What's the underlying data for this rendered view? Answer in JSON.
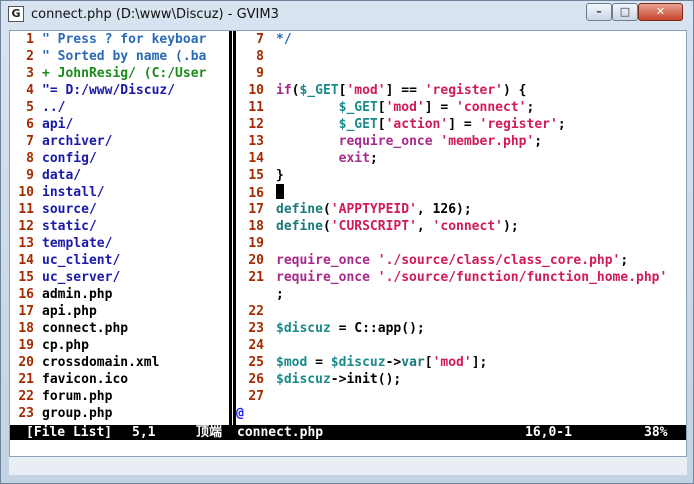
{
  "window": {
    "title": "connect.php (D:\\www\\Discuz) - GVIM3",
    "icon_glyph": "G"
  },
  "controls": {
    "minimize": "–",
    "maximize": "□",
    "close": "✕"
  },
  "left_pane": {
    "lines": [
      {
        "n": "1",
        "text": "\" Press ? for keyboar",
        "cls": "comment"
      },
      {
        "n": "2",
        "text": "\" Sorted by name (.ba",
        "cls": "comment"
      },
      {
        "n": "3",
        "text": "+ JohnResig/ (C:/User",
        "cls": "greenc"
      },
      {
        "n": "4",
        "text": "\"= D:/www/Discuz/",
        "cls": "dir"
      },
      {
        "n": "5",
        "text": "../",
        "cls": "dir"
      },
      {
        "n": "6",
        "text": "api/",
        "cls": "dir"
      },
      {
        "n": "7",
        "text": "archiver/",
        "cls": "dir"
      },
      {
        "n": "8",
        "text": "config/",
        "cls": "dir"
      },
      {
        "n": "9",
        "text": "data/",
        "cls": "dir"
      },
      {
        "n": "10",
        "text": "install/",
        "cls": "dir"
      },
      {
        "n": "11",
        "text": "source/",
        "cls": "dir"
      },
      {
        "n": "12",
        "text": "static/",
        "cls": "dir"
      },
      {
        "n": "13",
        "text": "template/",
        "cls": "dir"
      },
      {
        "n": "14",
        "text": "uc_client/",
        "cls": "dir"
      },
      {
        "n": "15",
        "text": "uc_server/",
        "cls": "dir"
      },
      {
        "n": "16",
        "text": "admin.php",
        "cls": "file"
      },
      {
        "n": "17",
        "text": "api.php",
        "cls": "file"
      },
      {
        "n": "18",
        "text": "connect.php",
        "cls": "file"
      },
      {
        "n": "19",
        "text": "cp.php",
        "cls": "file"
      },
      {
        "n": "20",
        "text": "crossdomain.xml",
        "cls": "file"
      },
      {
        "n": "21",
        "text": "favicon.ico",
        "cls": "file"
      },
      {
        "n": "22",
        "text": "forum.php",
        "cls": "file"
      },
      {
        "n": "23",
        "text": "group.php",
        "cls": "file"
      }
    ]
  },
  "right_pane": {
    "lines": [
      {
        "n": "7",
        "segs": [
          [
            "*/",
            "comment"
          ]
        ]
      },
      {
        "n": "8",
        "segs": []
      },
      {
        "n": "9",
        "segs": []
      },
      {
        "n": "10",
        "segs": [
          [
            "if",
            "kw"
          ],
          [
            "(",
            "op"
          ],
          [
            "$_GET",
            "var"
          ],
          [
            "[",
            "op"
          ],
          [
            "'mod'",
            "str"
          ],
          [
            "] == ",
            "op"
          ],
          [
            "'register'",
            "str"
          ],
          [
            ") {",
            "op"
          ]
        ]
      },
      {
        "n": "11",
        "segs": [
          [
            "        ",
            "op"
          ],
          [
            "$_GET",
            "var"
          ],
          [
            "[",
            "op"
          ],
          [
            "'mod'",
            "str"
          ],
          [
            "] = ",
            "op"
          ],
          [
            "'connect'",
            "str"
          ],
          [
            ";",
            "op"
          ]
        ]
      },
      {
        "n": "12",
        "segs": [
          [
            "        ",
            "op"
          ],
          [
            "$_GET",
            "var"
          ],
          [
            "[",
            "op"
          ],
          [
            "'action'",
            "str"
          ],
          [
            "] = ",
            "op"
          ],
          [
            "'register'",
            "str"
          ],
          [
            ";",
            "op"
          ]
        ]
      },
      {
        "n": "13",
        "segs": [
          [
            "        ",
            "op"
          ],
          [
            "require_once",
            "kw"
          ],
          [
            " ",
            "op"
          ],
          [
            "'member.php'",
            "str"
          ],
          [
            ";",
            "op"
          ]
        ]
      },
      {
        "n": "14",
        "segs": [
          [
            "        ",
            "op"
          ],
          [
            "exit",
            "kw"
          ],
          [
            ";",
            "op"
          ]
        ]
      },
      {
        "n": "15",
        "segs": [
          [
            "}",
            "op"
          ]
        ]
      },
      {
        "n": "16",
        "segs": [],
        "cursor": true
      },
      {
        "n": "17",
        "segs": [
          [
            "define",
            "fn"
          ],
          [
            "(",
            "op"
          ],
          [
            "'APPTYPEID'",
            "str"
          ],
          [
            ", 126);",
            "op"
          ]
        ]
      },
      {
        "n": "18",
        "segs": [
          [
            "define",
            "fn"
          ],
          [
            "(",
            "op"
          ],
          [
            "'CURSCRIPT'",
            "str"
          ],
          [
            ", ",
            "op"
          ],
          [
            "'connect'",
            "str"
          ],
          [
            ");",
            "op"
          ]
        ]
      },
      {
        "n": "19",
        "segs": []
      },
      {
        "n": "20",
        "segs": [
          [
            "require_once",
            "kw"
          ],
          [
            " ",
            "op"
          ],
          [
            "'./source/class/class_core.php'",
            "str"
          ],
          [
            ";",
            "op"
          ]
        ]
      },
      {
        "n": "21",
        "segs": [
          [
            "require_once",
            "kw"
          ],
          [
            " ",
            "op"
          ],
          [
            "'./source/function/function_home.php'",
            "str"
          ]
        ]
      },
      {
        "n": "",
        "segs": [
          [
            ";",
            "op"
          ]
        ]
      },
      {
        "n": "22",
        "segs": []
      },
      {
        "n": "23",
        "segs": [
          [
            "$discuz",
            "var"
          ],
          [
            " = C::app();",
            "op"
          ]
        ]
      },
      {
        "n": "24",
        "segs": []
      },
      {
        "n": "25",
        "segs": [
          [
            "$mod",
            "var"
          ],
          [
            " = ",
            "op"
          ],
          [
            "$discuz",
            "var"
          ],
          [
            "->",
            "op"
          ],
          [
            "var",
            "fn"
          ],
          [
            "[",
            "op"
          ],
          [
            "'mod'",
            "str"
          ],
          [
            "];",
            "op"
          ]
        ]
      },
      {
        "n": "26",
        "segs": [
          [
            "$discuz",
            "var"
          ],
          [
            "->init();",
            "op"
          ]
        ]
      },
      {
        "n": "27",
        "segs": []
      },
      {
        "n": "@",
        "segs": [],
        "eof": true
      }
    ]
  },
  "status": {
    "left_name": "[File List]",
    "left_pos": "5,1",
    "left_pct": "顶端",
    "right_name": "connect.php",
    "right_pos": "16,0-1",
    "right_pct": "38%"
  }
}
